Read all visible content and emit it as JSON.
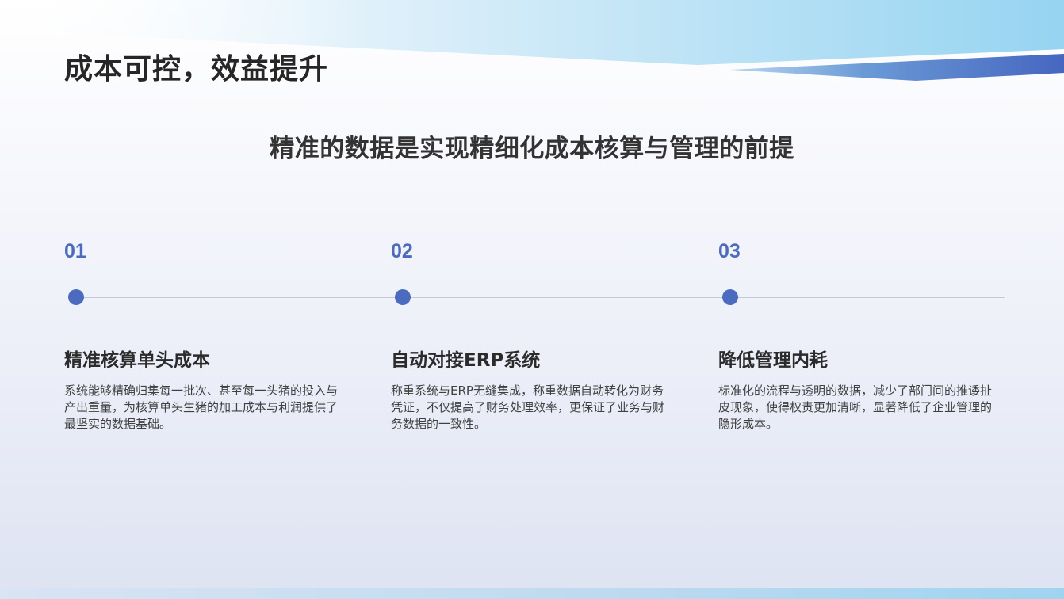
{
  "slide": {
    "title": "成本可控，效益提升",
    "subtitle": "精准的数据是实现精细化成本核算与管理的前提"
  },
  "steps": [
    {
      "number": "01",
      "heading": "精准核算单头成本",
      "body": "系统能够精确归集每一批次、甚至每一头猪的投入与产出重量，为核算单头生猪的加工成本与利润提供了最坚实的数据基础。"
    },
    {
      "number": "02",
      "heading": "自动对接ERP系统",
      "body": "称重系统与ERP无缝集成，称重数据自动转化为财务凭证，不仅提高了财务处理效率，更保证了业务与财务数据的一致性。"
    },
    {
      "number": "03",
      "heading": "降低管理内耗",
      "body": "标准化的流程与透明的数据，减少了部门间的推诿扯皮现象，使得权责更加清晰，显著降低了企业管理的隐形成本。"
    }
  ],
  "colors": {
    "accent": "#4a6bbf",
    "title_text": "#262626",
    "body_text": "#404040",
    "timeline": "#c5cad6"
  }
}
